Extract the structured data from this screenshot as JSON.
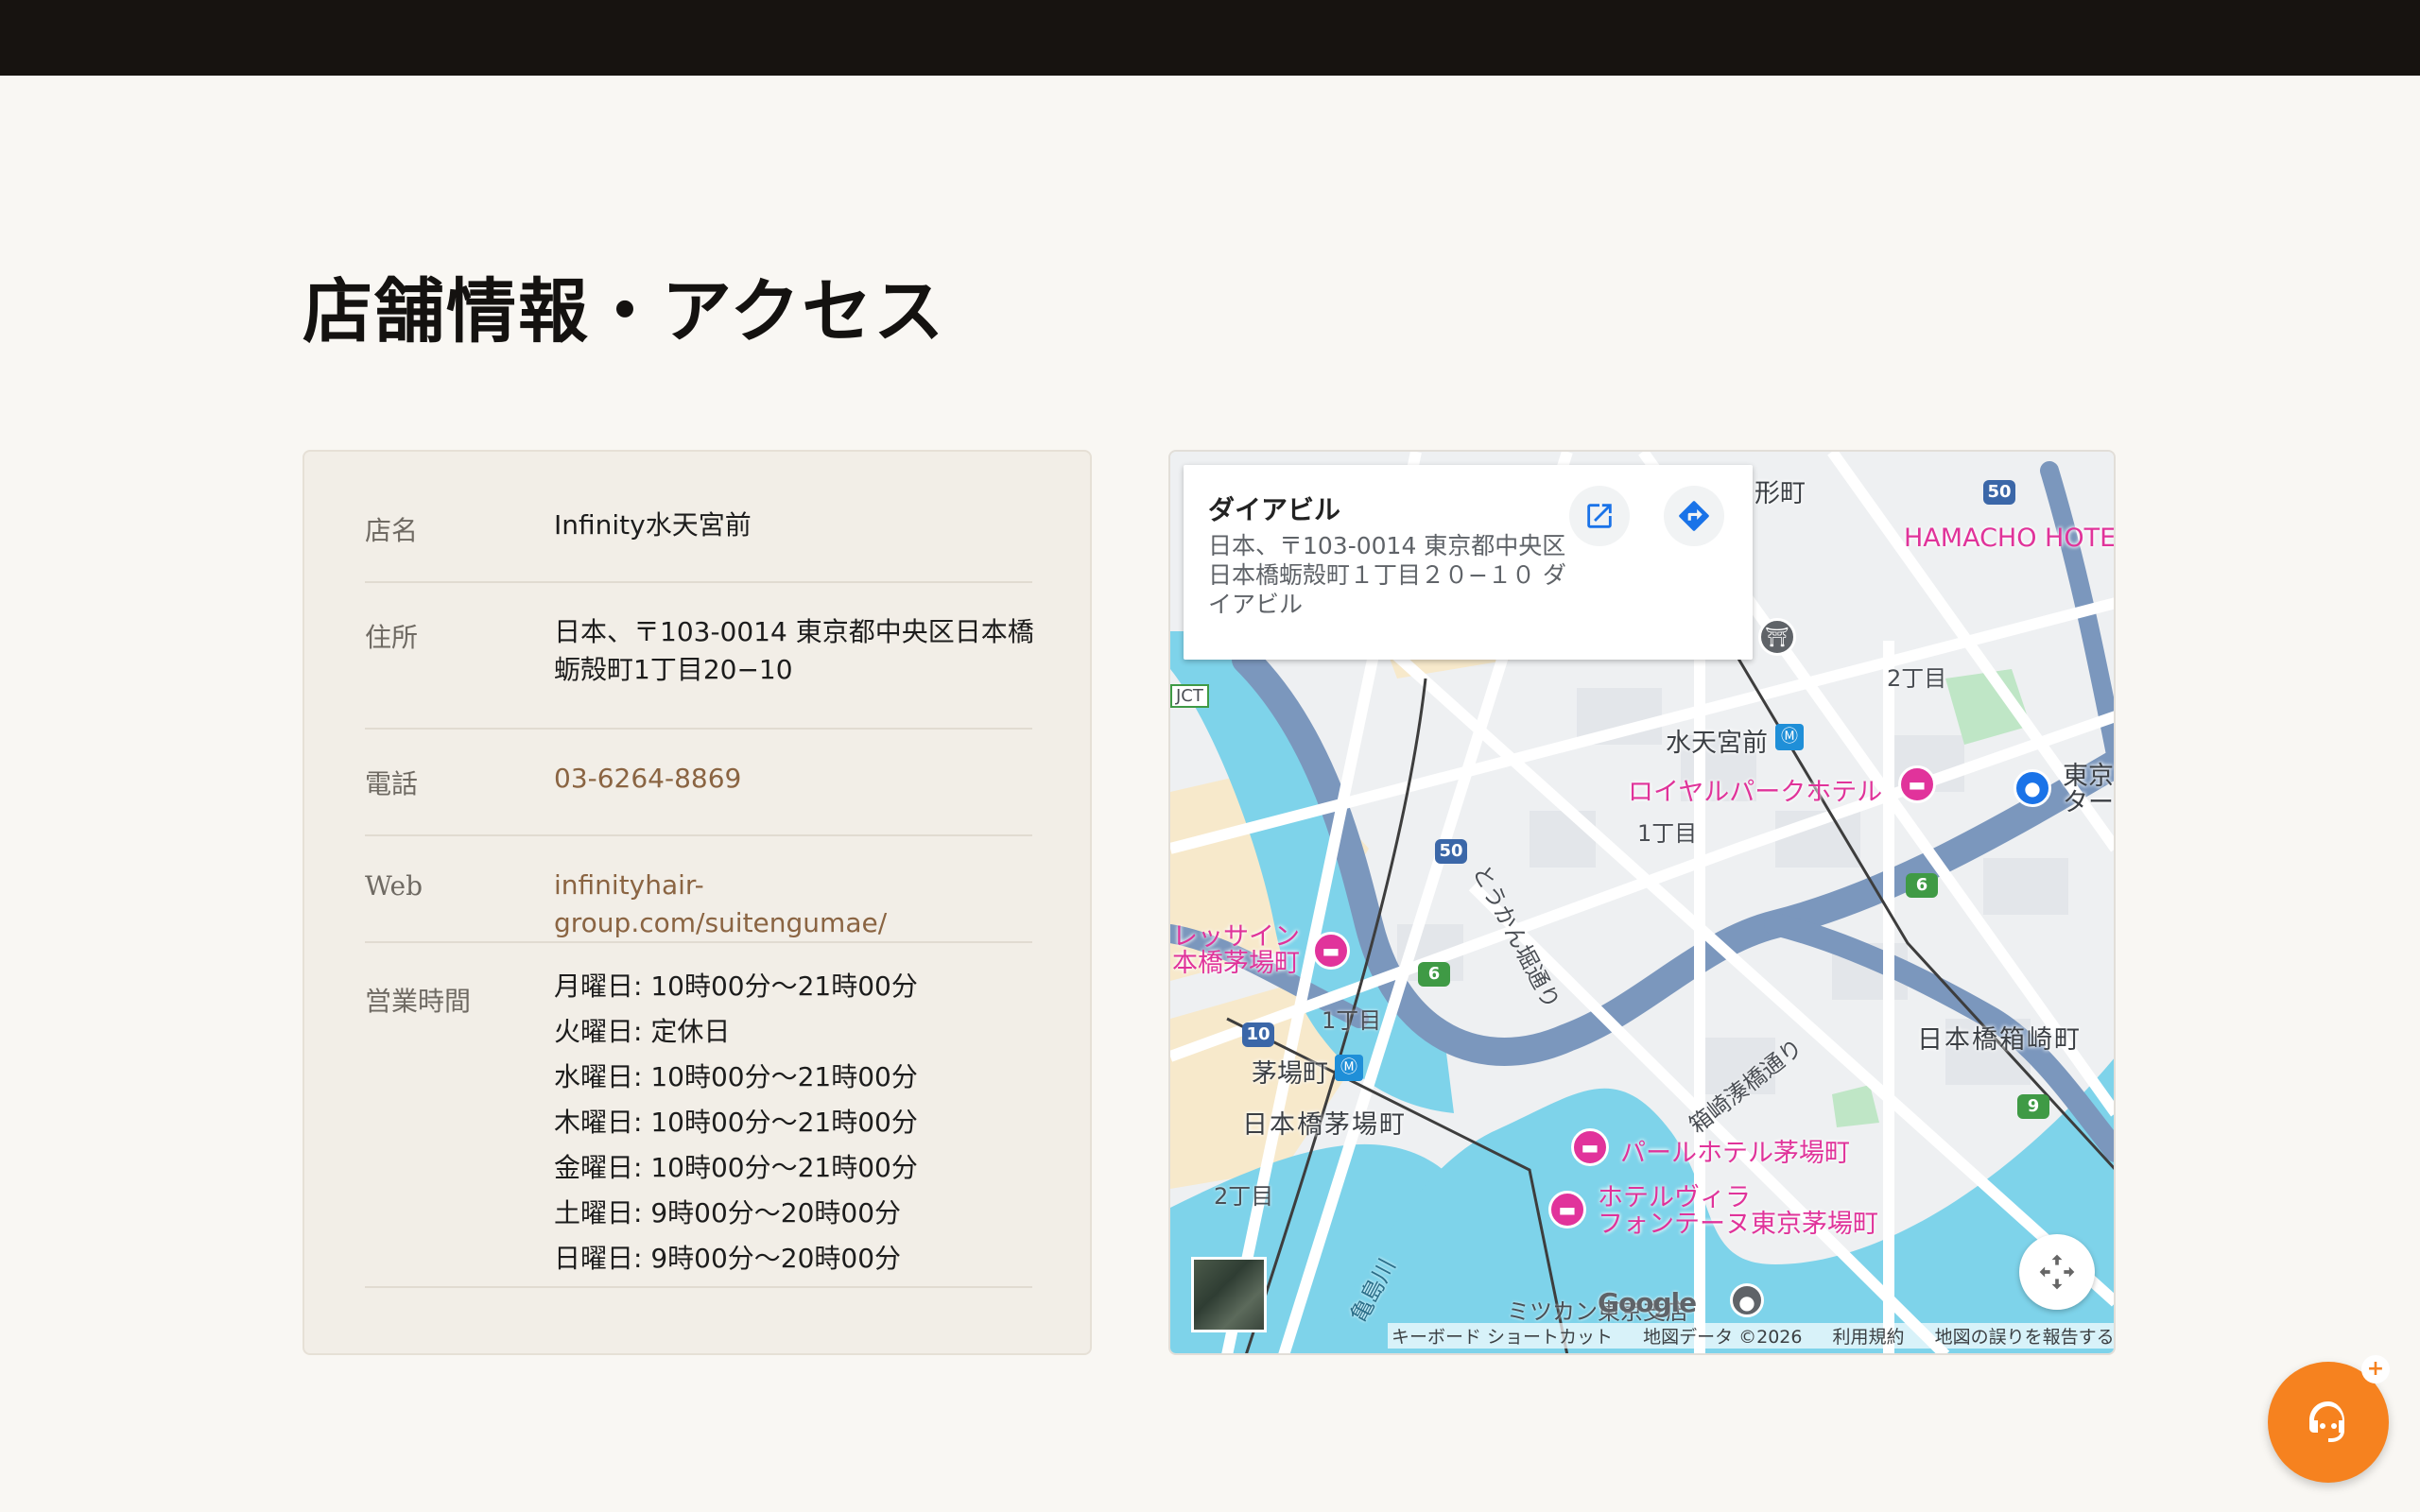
{
  "page": {
    "title": "店舗情報・アクセス"
  },
  "store": {
    "rows": [
      {
        "label": "店名",
        "value": "Infinity水天宮前"
      },
      {
        "label": "住所",
        "value": "日本、〒103-0014 東京都中央区日本橋蛎殻町1丁目20−10"
      },
      {
        "label": "電話",
        "value": "03-6264-8869"
      },
      {
        "label": "Web",
        "value": "infinityhair-group.com/suitengumae/"
      }
    ],
    "hours_label": "営業時間",
    "hours": [
      "月曜日: 10時00分～21時00分",
      "火曜日: 定休日",
      "水曜日: 10時00分～21時00分",
      "木曜日: 10時00分～21時00分",
      "金曜日: 10時00分～21時00分",
      "土曜日: 9時00分～20時00分",
      "日曜日: 9時00分～20時00分"
    ],
    "link_color": "#8a6442"
  },
  "map": {
    "place_card": {
      "name": "ダイアビル",
      "address": "日本、〒103-0014 東京都中央区日本橋蛎殻町１丁目２０−１０ ダイアビル"
    },
    "labels": {
      "ningyocho": "形町",
      "hamacho_hotel": "HAMACHO HOTEL",
      "chome2_top": "2丁目",
      "suitengumae": "水天宮前",
      "royal_park": "ロイヤルパークホテル",
      "tokyo_terminal": "東京\nター",
      "chome1_mid": "1丁目",
      "tokankaido": "とうかん堀通り",
      "jct": "JCT",
      "ressain": "レッサイン\n本橋茅場町",
      "chome1_left": "1丁目",
      "kayabacho": "茅場町",
      "nihonbashi_kayabacho": "日本橋茅場町",
      "hakozaki_dori": "箱崎湊橋通り",
      "nihonbashi_hakozaki": "日本橋箱崎町",
      "pearl_hotel": "パールホテル茅場町",
      "hotel_villa": "ホテルヴィラ\nフォンテーヌ東京茅場町",
      "chome2_left": "2丁目",
      "kameshima_river": "亀島川",
      "mitsukan": "ミツカン東京支店"
    },
    "shields": {
      "r50_top": "50",
      "r50_mid": "50",
      "r6_a": "6",
      "r6_b": "6",
      "r10": "10",
      "r9": "9"
    },
    "metro_icon": "metro-icon",
    "logo": "Google",
    "attribution": {
      "shortcuts": "キーボード ショートカット",
      "map_data": "地図データ ©2026",
      "terms": "利用規約",
      "report": "地図の誤りを報告する"
    },
    "colors": {
      "water": "#7ed3ea",
      "highway": "#7b97bd",
      "block": "#f7e9cb",
      "road": "#ffffff"
    }
  },
  "chat": {
    "icon": "chat-support-icon",
    "badge": "+"
  }
}
